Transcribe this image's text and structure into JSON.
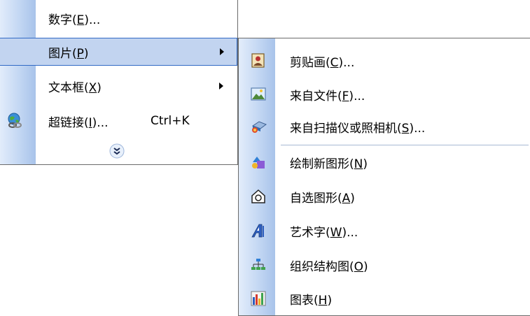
{
  "main_menu": {
    "items": [
      {
        "label": "数字",
        "accel": "E",
        "suffix": "..."
      },
      {
        "label": "图片",
        "accel": "P",
        "suffix": ""
      },
      {
        "label": "文本框",
        "accel": "X",
        "suffix": ""
      },
      {
        "label": "超链接",
        "accel": "I",
        "suffix": "...",
        "shortcut": "Ctrl+K"
      }
    ],
    "expand_icon": "double-chevron-down-icon"
  },
  "submenu": {
    "items": [
      {
        "label": "剪贴画",
        "accel": "C",
        "suffix": "...",
        "icon": "clip-art-icon"
      },
      {
        "label": "来自文件",
        "accel": "F",
        "suffix": "...",
        "icon": "picture-file-icon"
      },
      {
        "label": "来自扫描仪或照相机",
        "accel": "S",
        "suffix": "...",
        "icon": "scanner-camera-icon"
      },
      {
        "label": "绘制新图形",
        "accel": "N",
        "suffix": "",
        "icon": "new-drawing-icon"
      },
      {
        "label": "自选图形",
        "accel": "A",
        "suffix": "",
        "icon": "autoshapes-icon"
      },
      {
        "label": "艺术字",
        "accel": "W",
        "suffix": "...",
        "icon": "wordart-icon"
      },
      {
        "label": "组织结构图",
        "accel": "O",
        "suffix": "",
        "icon": "org-chart-icon"
      },
      {
        "label": "图表",
        "accel": "H",
        "suffix": "",
        "icon": "chart-icon"
      }
    ]
  }
}
